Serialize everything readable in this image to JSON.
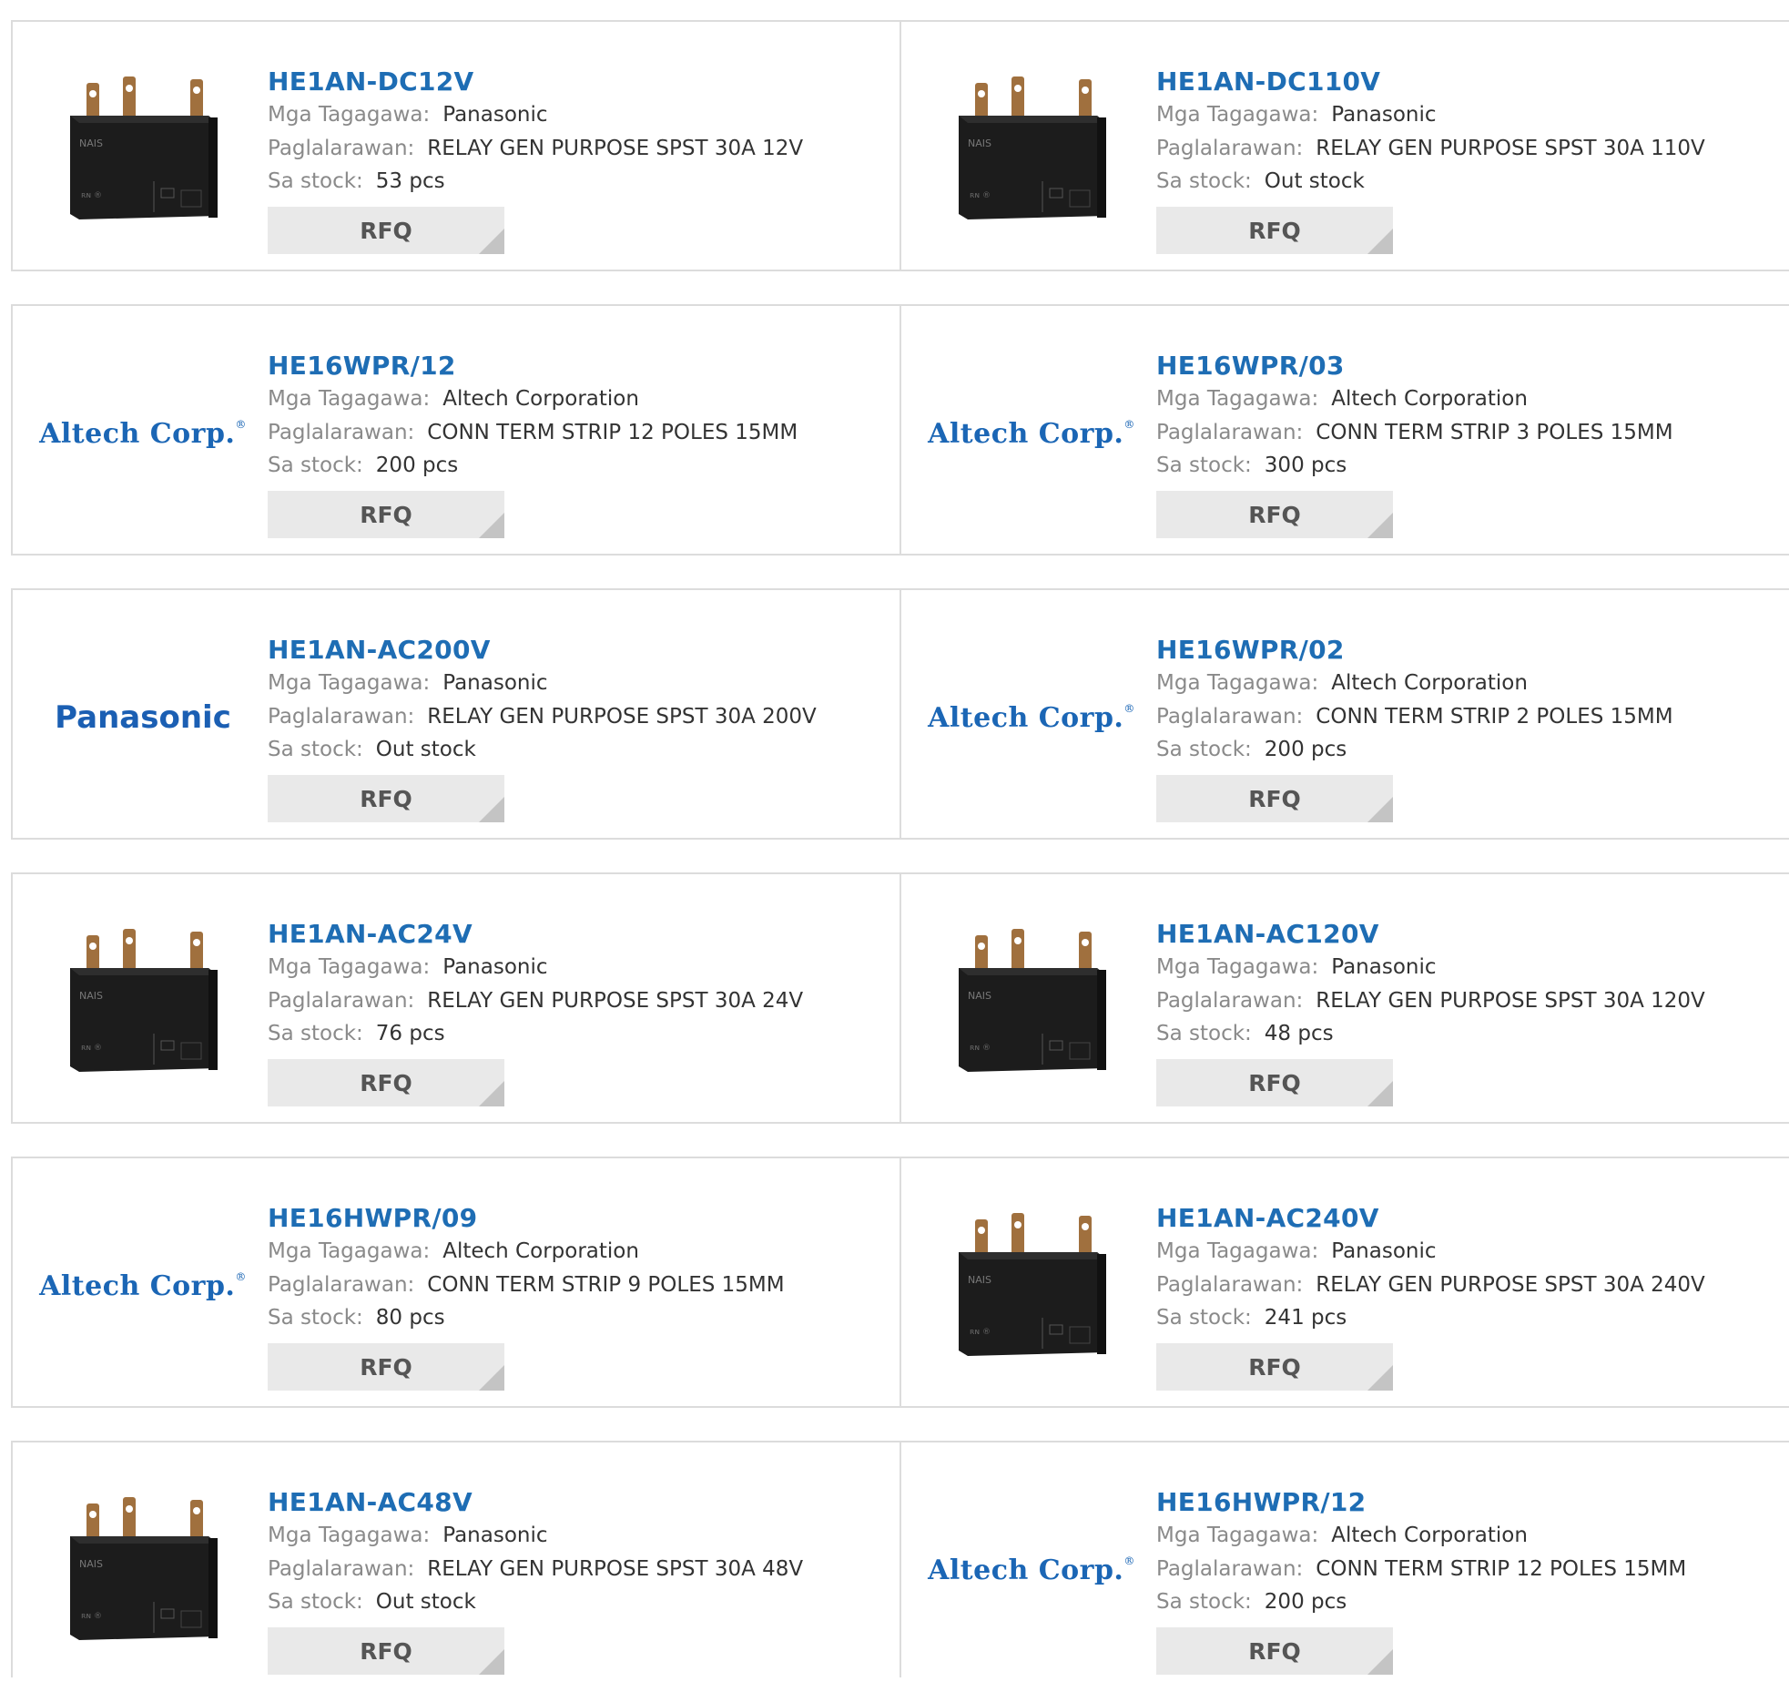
{
  "labels": {
    "manufacturer": "Mga Tagagawa:",
    "description": "Paglalarawan:",
    "stock": "Sa stock:",
    "rfq": "RFQ"
  },
  "products": [
    {
      "pn": "HE1AN-DC12V",
      "manufacturer": "Panasonic",
      "description": "RELAY GEN PURPOSE SPST 30A 12V",
      "stock": "53 pcs",
      "image": "relay-photo"
    },
    {
      "pn": "HE1AN-DC110V",
      "manufacturer": "Panasonic",
      "description": "RELAY GEN PURPOSE SPST 30A 110V",
      "stock": "Out stock",
      "image": "relay-photo"
    },
    {
      "pn": "HE16WPR/12",
      "manufacturer": "Altech Corporation",
      "description": "CONN TERM STRIP 12 POLES 15MM",
      "stock": "200 pcs",
      "image": "altech-logo"
    },
    {
      "pn": "HE16WPR/03",
      "manufacturer": "Altech Corporation",
      "description": "CONN TERM STRIP 3 POLES 15MM",
      "stock": "300 pcs",
      "image": "altech-logo"
    },
    {
      "pn": "HE1AN-AC200V",
      "manufacturer": "Panasonic",
      "description": "RELAY GEN PURPOSE SPST 30A 200V",
      "stock": "Out stock",
      "image": "panasonic-logo"
    },
    {
      "pn": "HE16WPR/02",
      "manufacturer": "Altech Corporation",
      "description": "CONN TERM STRIP 2 POLES 15MM",
      "stock": "200 pcs",
      "image": "altech-logo"
    },
    {
      "pn": "HE1AN-AC24V",
      "manufacturer": "Panasonic",
      "description": "RELAY GEN PURPOSE SPST 30A 24V",
      "stock": "76 pcs",
      "image": "relay-photo"
    },
    {
      "pn": "HE1AN-AC120V",
      "manufacturer": "Panasonic",
      "description": "RELAY GEN PURPOSE SPST 30A 120V",
      "stock": "48 pcs",
      "image": "relay-photo"
    },
    {
      "pn": "HE16HWPR/09",
      "manufacturer": "Altech Corporation",
      "description": "CONN TERM STRIP 9 POLES 15MM",
      "stock": "80 pcs",
      "image": "altech-logo"
    },
    {
      "pn": "HE1AN-AC240V",
      "manufacturer": "Panasonic",
      "description": "RELAY GEN PURPOSE SPST 30A 240V",
      "stock": "241 pcs",
      "image": "relay-photo"
    },
    {
      "pn": "HE1AN-AC48V",
      "manufacturer": "Panasonic",
      "description": "RELAY GEN PURPOSE SPST 30A 48V",
      "stock": "Out stock",
      "image": "relay-photo"
    },
    {
      "pn": "HE16HWPR/12",
      "manufacturer": "Altech Corporation",
      "description": "CONN TERM STRIP 12 POLES 15MM",
      "stock": "200 pcs",
      "image": "altech-logo"
    }
  ],
  "logos": {
    "altech": "Altech Corp.",
    "altech_mark": "®",
    "panasonic": "Panasonic",
    "relay_brand": "NAIS"
  },
  "colors": {
    "link": "#1e6db4",
    "label": "#8a8a8a",
    "border": "#dcdcdc",
    "rfq_bg": "#e9e9e9"
  }
}
